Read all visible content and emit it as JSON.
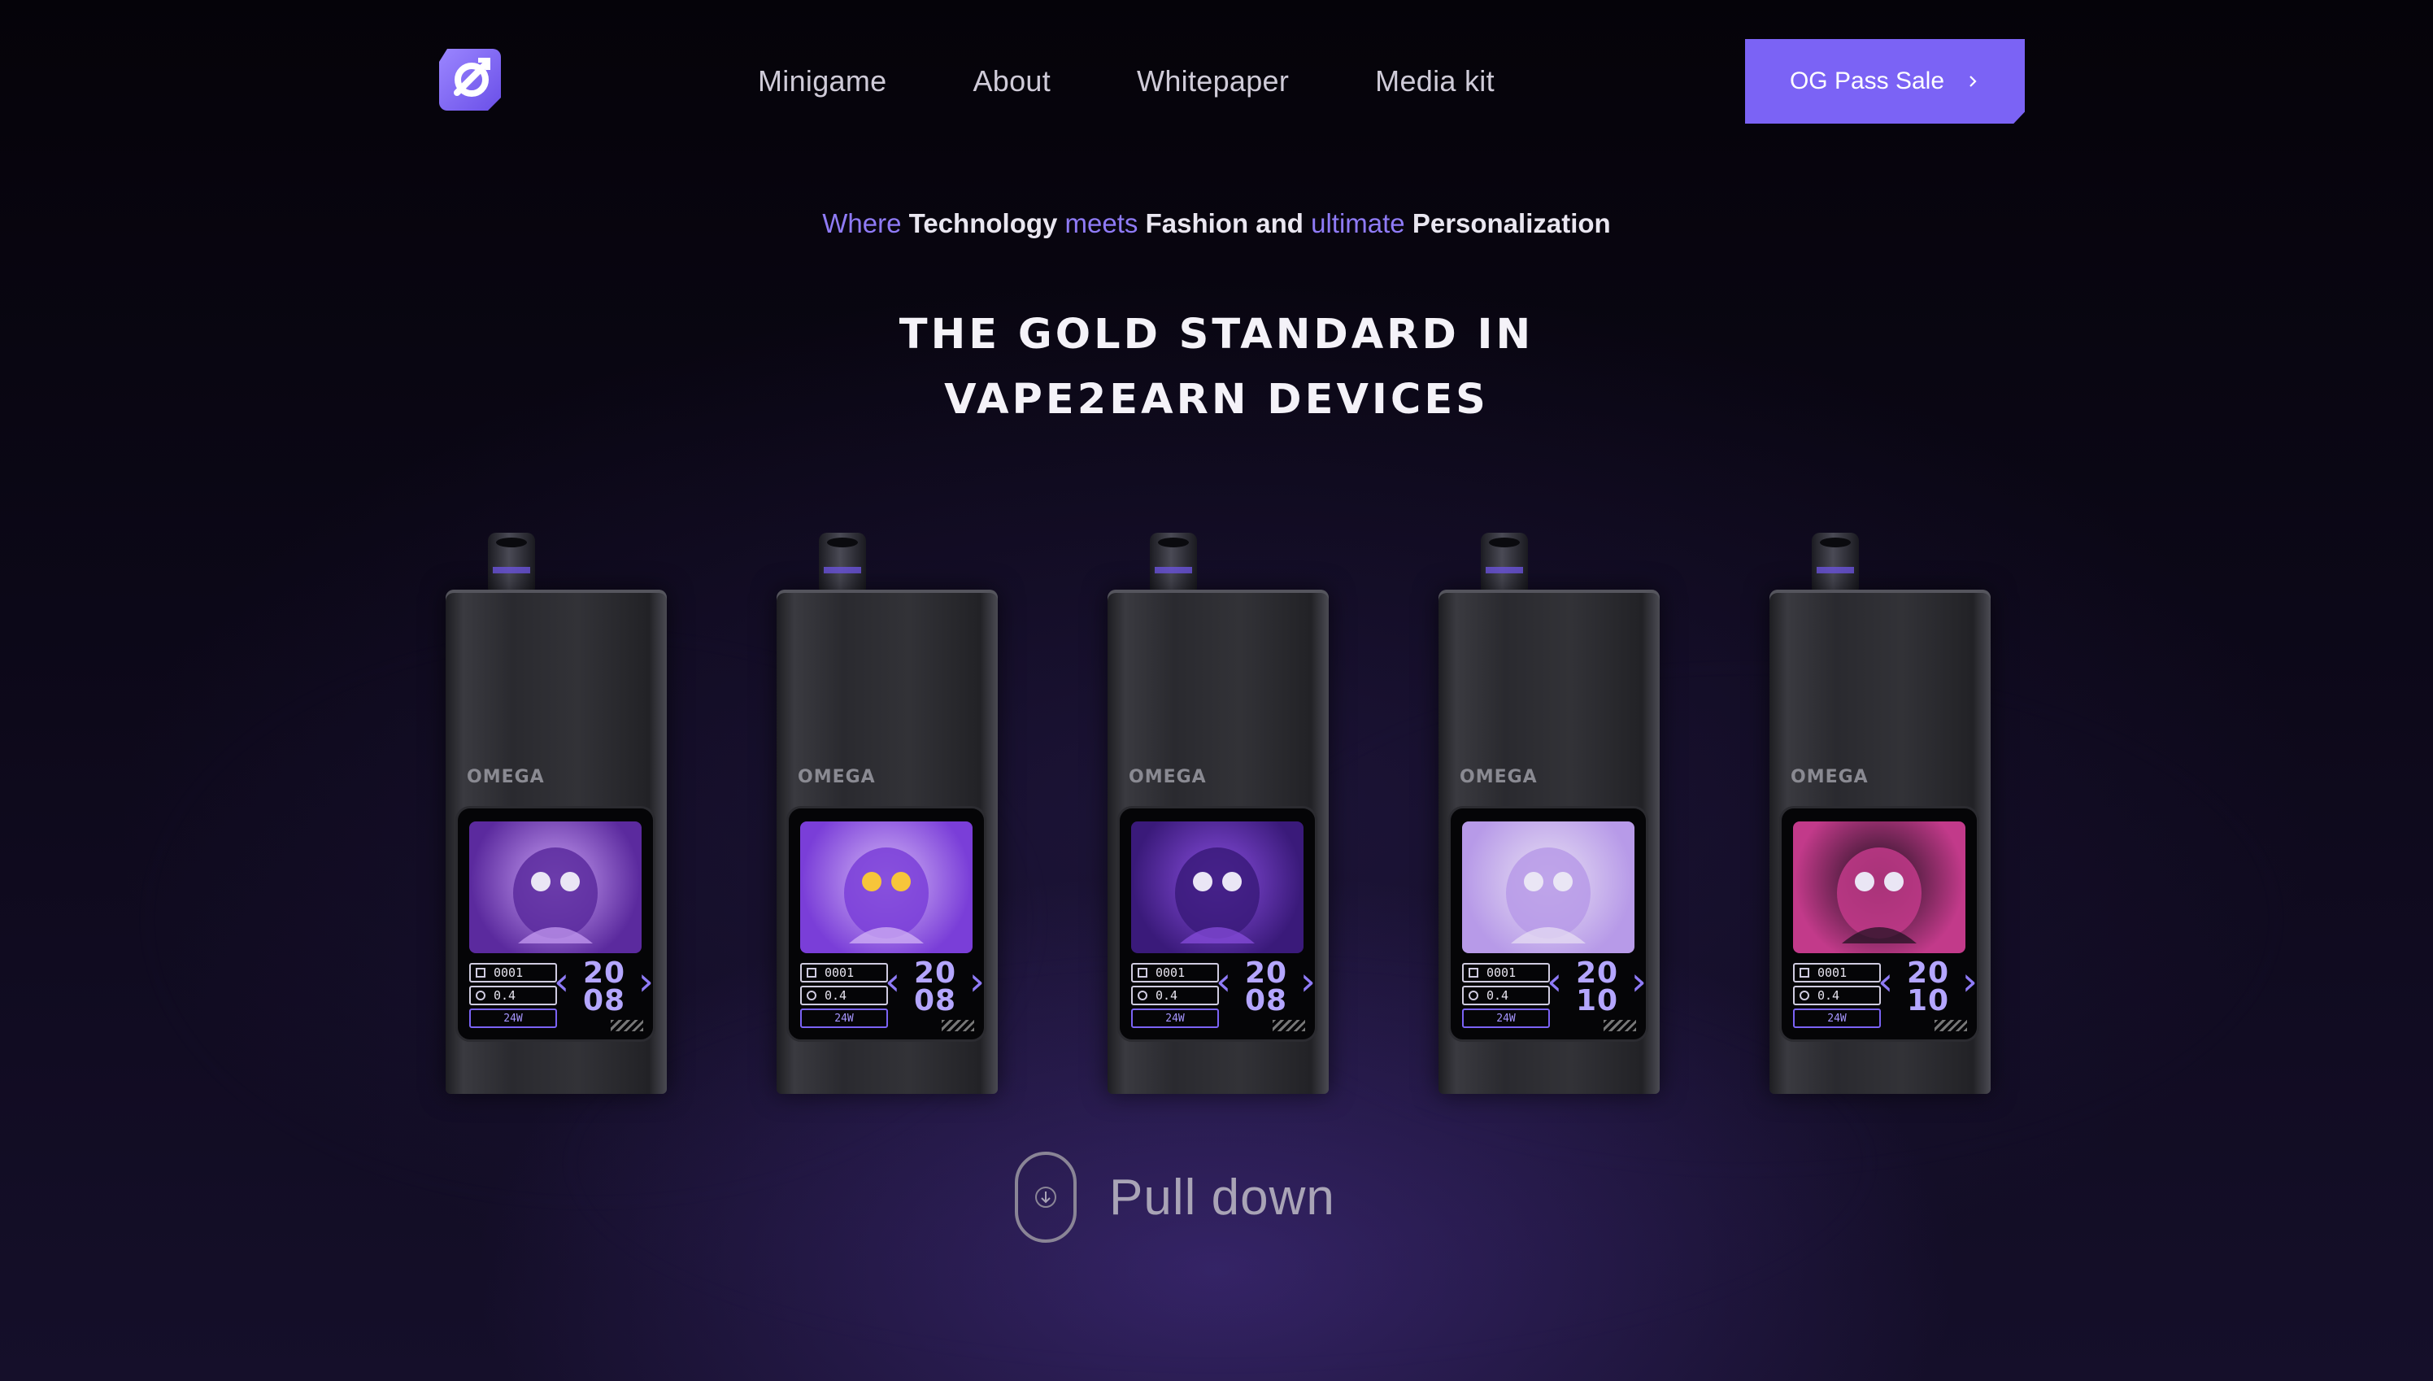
{
  "nav": {
    "logo": "qs-logo",
    "links": [
      "Minigame",
      "About",
      "Whitepaper",
      "Media kit"
    ],
    "cta_label": "OG Pass Sale",
    "cta_icon": "chevron-right-icon",
    "accent": "#7b63f5"
  },
  "hero": {
    "tagline": [
      {
        "text": "Where ",
        "style": "purple"
      },
      {
        "text": "Technology ",
        "style": "bold"
      },
      {
        "text": "meets ",
        "style": "purple"
      },
      {
        "text": "Fashion and ",
        "style": "bold"
      },
      {
        "text": "ultimate ",
        "style": "purple"
      },
      {
        "text": "Personalization",
        "style": "bold"
      }
    ],
    "headline_line1": "THE GOLD STANDARD IN",
    "headline_line2": "VAPE2EARN DEVICES"
  },
  "devices": [
    {
      "brand": "OMEGA",
      "art": "crow-mask-character",
      "art_colors": [
        "#c9a0f5",
        "#5b2a9e"
      ],
      "puffs": "0001",
      "ohms": "0.4",
      "watts": "24W",
      "date_top": "20",
      "date_bottom": "08"
    },
    {
      "brand": "OMEGA",
      "art": "skull-character",
      "art_colors": [
        "#d5b8f7",
        "#7a3ed8"
      ],
      "puffs": "0001",
      "ohms": "0.4",
      "watts": "24W",
      "date_top": "20",
      "date_bottom": "08"
    },
    {
      "brand": "OMEGA",
      "art": "omega-hands-emblem",
      "art_colors": [
        "#8a4fe0",
        "#3a1a7a"
      ],
      "puffs": "0001",
      "ohms": "0.4",
      "watts": "24W",
      "date_top": "20",
      "date_bottom": "08"
    },
    {
      "brand": "OMEGA",
      "art": "robot-character",
      "art_colors": [
        "#e8e0f4",
        "#b79ae8"
      ],
      "puffs": "0001",
      "ohms": "0.4",
      "watts": "24W",
      "date_top": "20",
      "date_bottom": "10"
    },
    {
      "brand": "OMEGA",
      "art": "masked-ninja-character",
      "art_colors": [
        "#1a0f1c",
        "#c23a8a"
      ],
      "puffs": "0001",
      "ohms": "0.4",
      "watts": "24W",
      "date_top": "20",
      "date_bottom": "10"
    }
  ],
  "pull": {
    "label": "Pull down",
    "icon": "scroll-down-arrow-icon"
  }
}
